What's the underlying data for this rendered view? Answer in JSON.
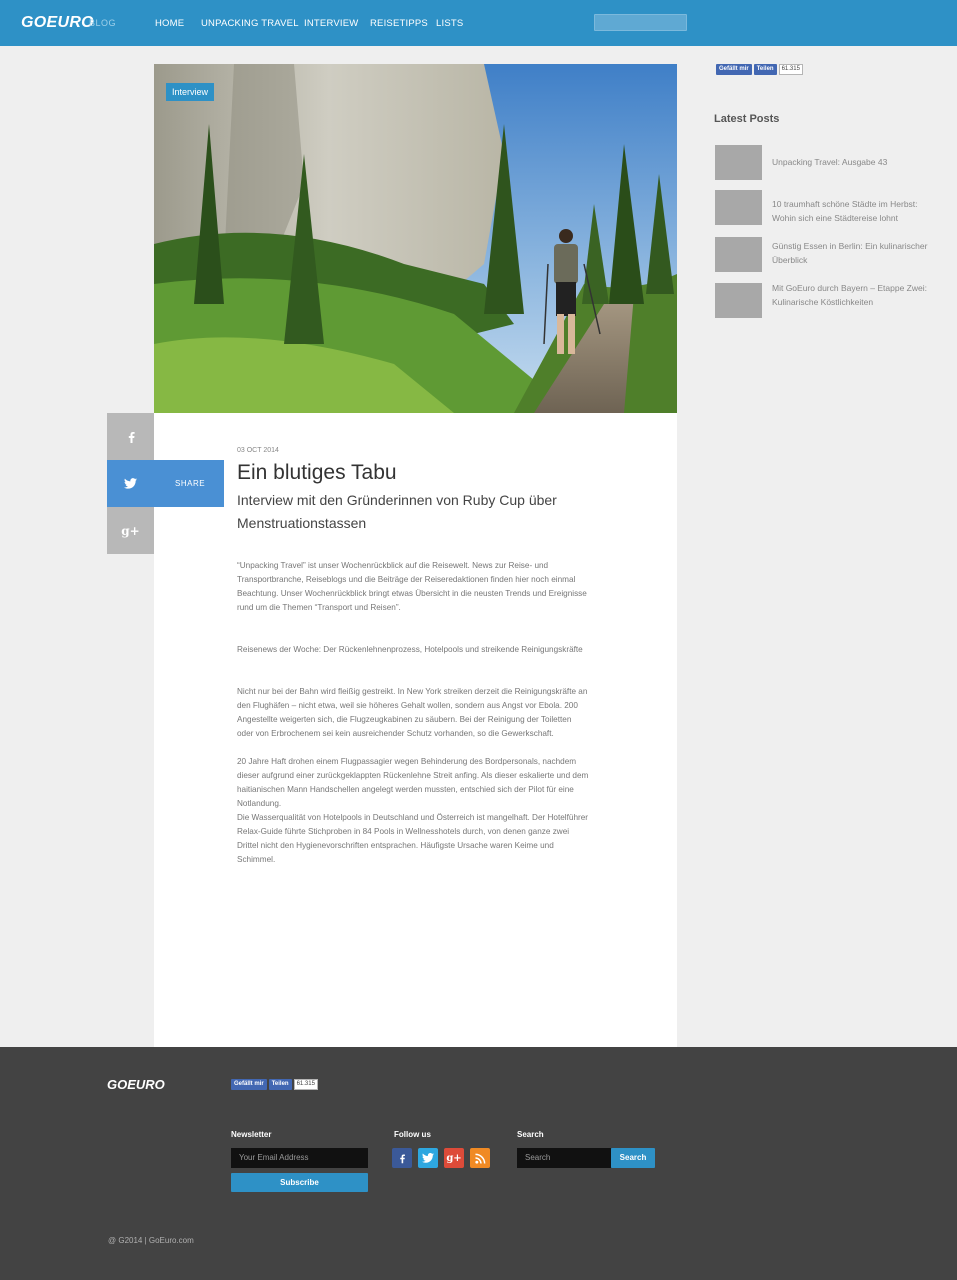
{
  "header": {
    "logo": "GOEURO",
    "logo_sub": "BLOG",
    "nav": [
      "HOME",
      "UNPACKING TRAVEL",
      "INTERVIEW",
      "REISETIPPS",
      "LISTS"
    ]
  },
  "article": {
    "tag": "Interview",
    "date": "03 OCT 2014",
    "title": "Ein blutiges Tabu",
    "subtitle": "Interview mit den Gründerinnen von Ruby Cup über Menstruationstassen",
    "share_label": "SHARE",
    "paragraphs": [
      "“Unpacking Travel” ist unser Wochenrückblick auf die Reisewelt. News zur Reise- und Transportbranche, Reiseblogs und die Beiträge der Reiseredaktionen finden hier noch einmal Beachtung. Unser Wochenrückblick bringt etwas Übersicht in die neusten Trends und Ereignisse rund um die Themen “Transport und Reisen”.",
      "Reisenews der Woche: Der Rückenlehnenprozess, Hotelpools und streikende Reinigungskräfte",
      "Nicht nur bei der Bahn wird fleißig gestreikt. In New York streiken derzeit die Reinigungskräfte an den Flughäfen – nicht etwa, weil sie höheres Gehalt wollen, sondern aus Angst vor Ebola. 200 Angestellte weigerten sich, die Flugzeugkabinen zu säubern. Bei der Reinigung der Toiletten oder von Erbrochenem sei kein ausreichender Schutz vorhanden, so die Gewerkschaft.",
      "20 Jahre Haft drohen einem Flugpassagier wegen Behinderung des Bordpersonals, nachdem dieser aufgrund einer zurückgeklappten Rückenlehne Streit anfing. Als dieser eskalierte und dem haitianischen Mann Handschellen angelegt werden mussten, entschied sich der Pilot für eine Notlandung.",
      "Die Wasserqualität von Hotelpools in Deutschland und Österreich ist mangelhaft. Der Hotelführer Relax-Guide führte Stichproben in 84 Pools in Wellnesshotels durch, von denen ganze zwei Drittel nicht den Hygienevorschriften entsprachen. Häufigste Ursache waren Keime und Schimmel."
    ]
  },
  "facebook": {
    "like": "Gefällt mir",
    "share": "Teilen",
    "count": "61.315"
  },
  "sidebar": {
    "heading": "Latest Posts",
    "posts": [
      "Unpacking Travel: Ausgabe 43",
      "10 traumhaft schöne Städte im Herbst: Wohin sich eine Städtereise lohnt",
      "Günstig Essen in Berlin: Ein kulinarischer Überblick",
      "Mit GoEuro durch Bayern – Etappe Zwei: Kulinarische Köstlichkeiten"
    ]
  },
  "footer": {
    "logo": "GOEURO",
    "newsletter_heading": "Newsletter",
    "email_placeholder": "Your Email Address",
    "subscribe": "Subscribe",
    "follow_heading": "Follow us",
    "search_heading": "Search",
    "search_placeholder": "Search",
    "search_button": "Search",
    "copyright": "@ G2014 | GoEuro.com"
  },
  "colors": {
    "brand_blue": "#2e91c6",
    "twitter_share": "#4a90d4",
    "footer_bg": "#434343"
  },
  "icons": [
    "facebook-icon",
    "twitter-icon",
    "google-plus-icon",
    "rss-icon"
  ]
}
